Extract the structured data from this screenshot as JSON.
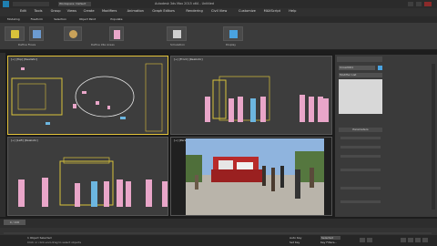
{
  "app": {
    "title": "Autodesk 3ds Max 2015 x64 - Untitled",
    "workspace": "Workspace: Default"
  },
  "menu": [
    "Edit",
    "Tools",
    "Group",
    "Views",
    "Create",
    "Modifiers",
    "Animation",
    "Graph Editors",
    "Rendering",
    "Civil View",
    "Customize",
    "MAXScript",
    "Help"
  ],
  "ribbon": {
    "tabs": [
      "Modeling",
      "Freeform",
      "Selection",
      "Object Paint",
      "Populate"
    ],
    "groups": [
      "Define Flows",
      "Define Idle Areas",
      "Simulation",
      "Display"
    ],
    "buttons": [
      "Create Flow",
      "Simulate",
      "Display"
    ]
  },
  "viewports": [
    {
      "label": "[+] [Top] [Realistic]"
    },
    {
      "label": "[+] [Front] [Realistic]"
    },
    {
      "label": "[+] [Left] [Realistic]"
    },
    {
      "label": "[+] [Perspective] [Realistic]"
    }
  ],
  "command_panel": {
    "object_name": "Crowd001",
    "list_label": "Modifier List",
    "rollout_title": "Parameters"
  },
  "timeline": {
    "frame_display": "0 / 100"
  },
  "status": {
    "selection": "1 Object Selected",
    "prompt": "Click or click-and-drag to select objects",
    "auto_key": "Auto Key",
    "set_key": "Set Key",
    "key_filters": "Key Filters...",
    "selected": "Selected"
  },
  "colors": {
    "accent_blue": "#4aa3e0",
    "people_pink": "#e9a6c9",
    "bbox_yellow": "#d9c23a",
    "sky_blue": "#8fb4de"
  }
}
